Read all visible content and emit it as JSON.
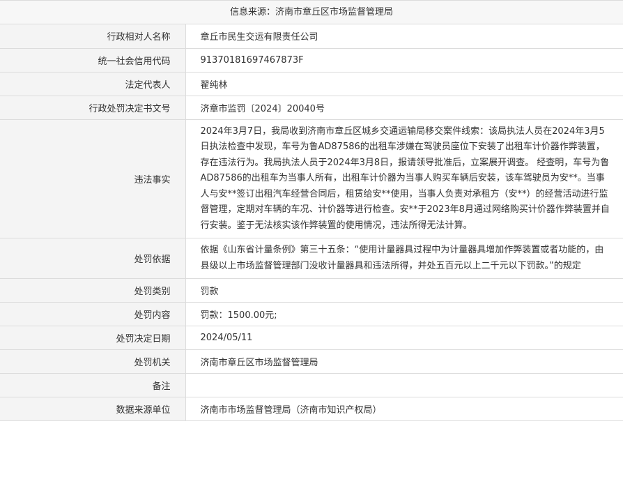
{
  "source": "信息来源：济南市章丘区市场监督管理局",
  "rows": [
    {
      "label": "行政相对人名称",
      "value": "章丘市民生交运有限责任公司"
    },
    {
      "label": "统一社会信用代码",
      "value": "91370181697467873F"
    },
    {
      "label": "法定代表人",
      "value": "翟纯林"
    },
    {
      "label": "行政处罚决定书文号",
      "value": "济章市监罚〔2024〕20040号"
    },
    {
      "label": "违法事实",
      "value": "2024年3月7日，我局收到济南市章丘区城乡交通运输局移交案件线索：该局执法人员在2024年3月5日执法检查中发现，车号为鲁AD87586的出租车涉嫌在驾驶员座位下安装了出租车计价器作弊装置，存在违法行为。我局执法人员于2024年3月8日，报请领导批准后，立案展开调查。 经查明，车号为鲁AD87586的出租车为当事人所有，出租车计价器为当事人购买车辆后安装，该车驾驶员为安**。当事人与安**签订出租汽车经营合同后，租赁给安**使用，当事人负责对承租方（安**）的经营活动进行监督管理，定期对车辆的车况、计价器等进行检查。安**于2023年8月通过网络购买计价器作弊装置并自行安装。鉴于无法核实该作弊装置的使用情况，违法所得无法计算。"
    },
    {
      "label": "处罚依据",
      "value": "依据《山东省计量条例》第三十五条：“使用计量器具过程中为计量器具增加作弊装置或者功能的，由县级以上市场监督管理部门没收计量器具和违法所得，并处五百元以上二千元以下罚款。”的规定"
    },
    {
      "label": "处罚类别",
      "value": "罚款"
    },
    {
      "label": "处罚内容",
      "value": "罚款：1500.00元;"
    },
    {
      "label": "处罚决定日期",
      "value": "2024/05/11"
    },
    {
      "label": "处罚机关",
      "value": "济南市章丘区市场监督管理局"
    },
    {
      "label": "备注",
      "value": ""
    },
    {
      "label": "数据来源单位",
      "value": "济南市市场监督管理局（济南市知识产权局）"
    }
  ]
}
